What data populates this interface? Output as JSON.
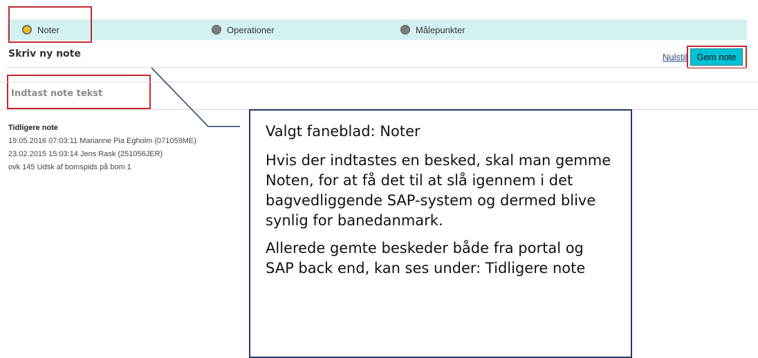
{
  "tabs": [
    {
      "label": "Noter",
      "active": true
    },
    {
      "label": "Operationer",
      "active": false
    },
    {
      "label": "Målepunkter",
      "active": false
    }
  ],
  "form": {
    "heading": "Skriv ny note",
    "reset_label": "Nulstil",
    "save_label": "Gem note",
    "note_placeholder": "Indtast note tekst"
  },
  "previous_notes": {
    "title": "Tidligere note",
    "entries": [
      "19.05.2016 07:03:11 Marianne Pia Egholm (071059ME)",
      "23.02.2015 15:03:14 Jens Rask (251056JER)",
      "ovk 145 Udsk af bomspids på bom 1"
    ]
  },
  "callout": {
    "line1": "Valgt faneblad: Noter",
    "line2": "Hvis der indtastes en besked, skal man gemme Noten, for at få det til at slå igennem i det bagvedliggende SAP-system og dermed blive synlig for banedanmark.",
    "line3": "Allerede gemte beskeder både fra portal og SAP back end, kan ses under: Tidligere note"
  },
  "colors": {
    "tab_bar": "#d4f1f1",
    "active_dot": "#f2c21a",
    "inactive_dot": "#7c7c7c",
    "highlight_border": "#c0282e",
    "save_button": "#00c2d6",
    "callout_border": "#1f3a66"
  }
}
